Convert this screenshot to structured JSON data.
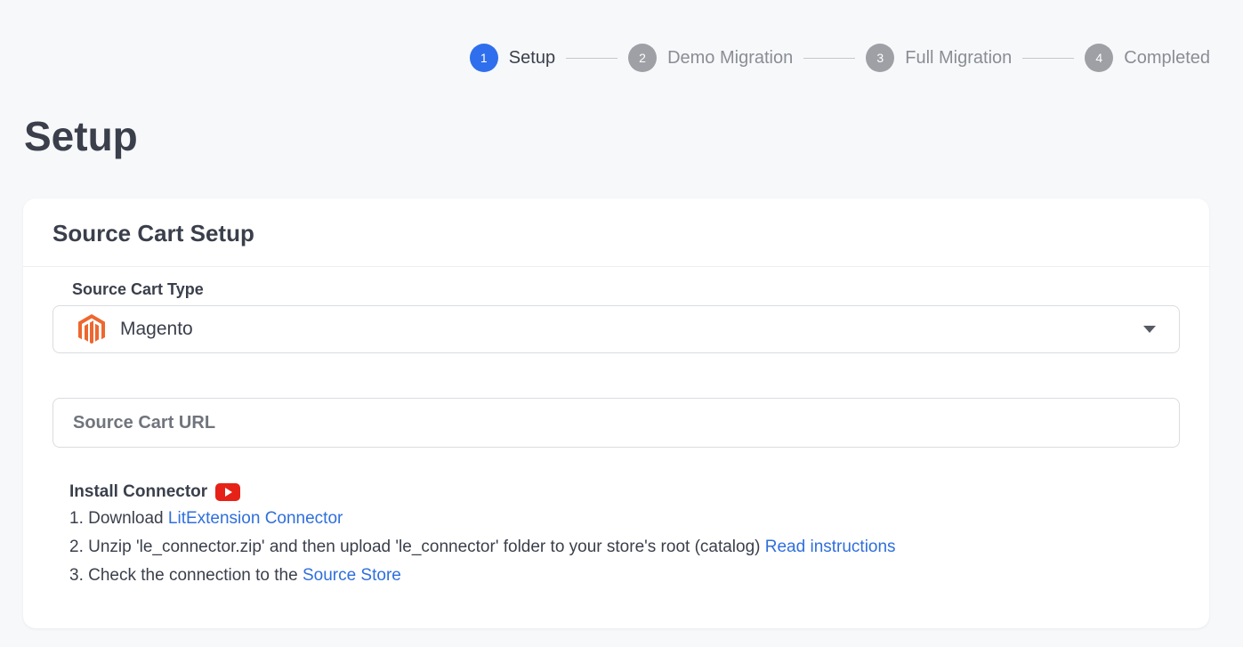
{
  "stepper": {
    "steps": [
      {
        "number": "1",
        "label": "Setup"
      },
      {
        "number": "2",
        "label": "Demo Migration"
      },
      {
        "number": "3",
        "label": "Full Migration"
      },
      {
        "number": "4",
        "label": "Completed"
      }
    ],
    "active_color": "#2f6fed",
    "inactive_color": "#9ea0a5"
  },
  "page": {
    "title": "Setup"
  },
  "card": {
    "title": "Source Cart Setup",
    "cart_type_label": "Source Cart Type",
    "cart_type_value": "Magento",
    "cart_type_icon": "magento-icon",
    "url_placeholder": "Source Cart URL",
    "url_value": ""
  },
  "instructions": {
    "title": "Install Connector",
    "title_icon": "youtube-icon",
    "step1_text": "1. Download ",
    "step1_link": "LitExtension Connector",
    "step2_text": "2. Unzip 'le_connector.zip' and then upload 'le_connector' folder to your store's root (catalog) ",
    "step2_link": "Read instructions",
    "step3_text": "3. Check the connection to the ",
    "step3_link": "Source Store"
  }
}
